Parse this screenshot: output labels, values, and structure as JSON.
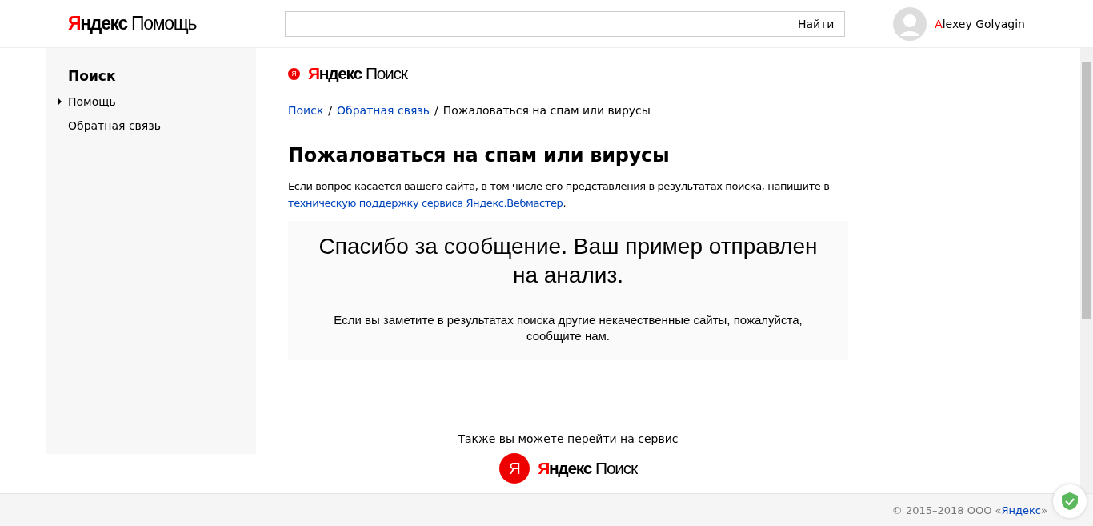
{
  "header": {
    "logo": {
      "brand": "Яндекс",
      "service": "Помощь"
    },
    "search": {
      "button": "Найти"
    },
    "user": {
      "name": "Alexey Golyagin"
    }
  },
  "sidebar": {
    "title": "Поиск",
    "items": [
      {
        "label": "Помощь",
        "selected": true
      },
      {
        "label": "Обратная связь",
        "selected": false
      }
    ]
  },
  "service_logo": {
    "mark": "Я",
    "brand": "Яндекс",
    "service": "Поиск"
  },
  "breadcrumbs": [
    {
      "label": "Поиск",
      "kind": "link"
    },
    {
      "separator": "/",
      "label": "Обратная связь",
      "kind": "link"
    },
    {
      "separator": "/",
      "label": "Пожаловаться на спам или вирусы",
      "kind": "current"
    }
  ],
  "title": "Пожаловаться на спам или вирусы",
  "intro": {
    "before": "Если вопрос касается вашего сайта, в том числе его представления в результатах поиска, напишите в ",
    "link": "техническую поддержку сервиса Яндекс.Вебмастер",
    "after": "."
  },
  "message": {
    "heading": "Спасибо за сообщение. Ваш пример отправлен на анализ.",
    "text": "Если вы заметите в результатах поиска другие некачественные сайты, пожалуйста, сообщите нам."
  },
  "service_promo": {
    "text": "Также вы можете перейти на сервис",
    "logo": {
      "mark": "Я",
      "brand": "Яндекс",
      "service": "Поиск"
    }
  },
  "footer": {
    "before": "© 2015–2018 ООО «",
    "link": "Яндекс",
    "after": "»"
  }
}
